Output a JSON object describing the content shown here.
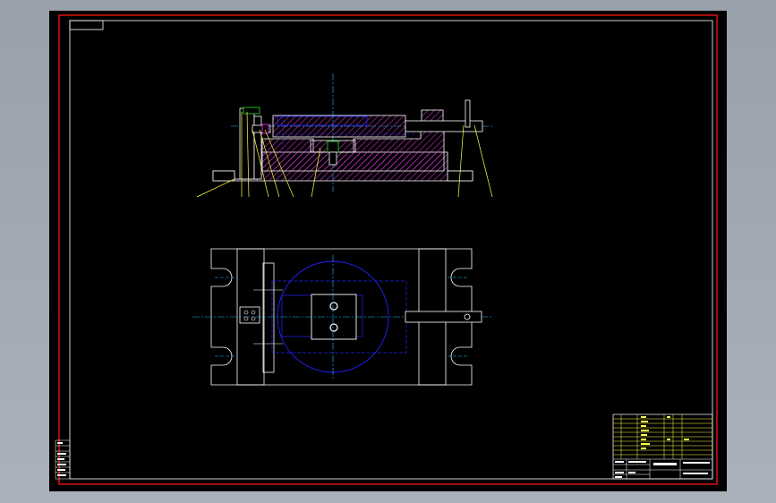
{
  "drawing": {
    "background_color": "#000000",
    "frame_color": "#d01010",
    "border_color": "#ffffff",
    "part_outline_color": "#ffffff",
    "hatch_color": "#cc33cc",
    "hidden_line_color": "#2222ff",
    "center_line_color": "#22bbff",
    "leader_color": "#ffff44",
    "accent_green": "#22dd22"
  },
  "views": [
    {
      "name": "front-section-view"
    },
    {
      "name": "top-plan-view"
    }
  ],
  "title_block": {
    "visible_text": []
  }
}
